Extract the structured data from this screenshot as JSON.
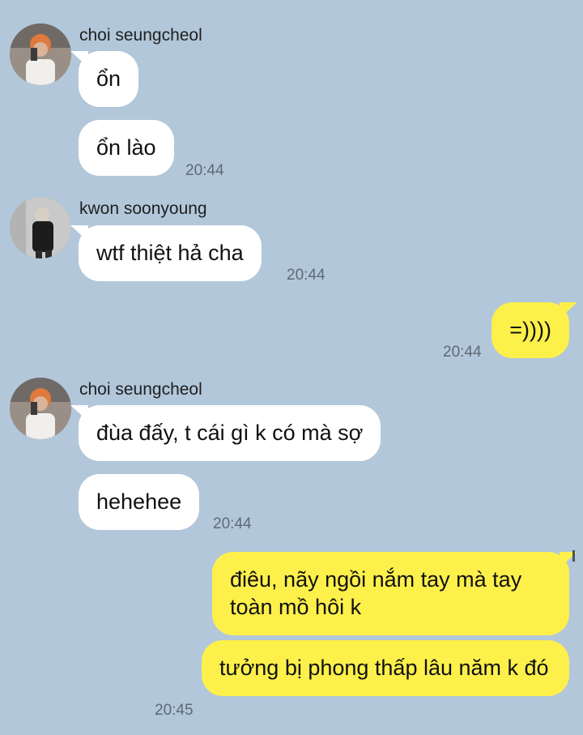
{
  "colors": {
    "background": "#b2c7da",
    "incoming_bubble": "#ffffff",
    "outgoing_bubble": "#fdf04b",
    "timestamp": "#5e6a74"
  },
  "groups": [
    {
      "sender": "choi seungcheol",
      "avatar_icon": "profile-photo-orange-hair",
      "messages": [
        "ổn",
        "ổn lào"
      ],
      "time": "20:44"
    },
    {
      "sender": "kwon soonyoung",
      "avatar_icon": "profile-photo-black-outfit",
      "messages": [
        "wtf thiệt hả cha"
      ],
      "time": "20:44"
    },
    {
      "sender": "",
      "outgoing": true,
      "messages": [
        "=))))"
      ],
      "time": "20:44"
    },
    {
      "sender": "choi seungcheol",
      "avatar_icon": "profile-photo-orange-hair",
      "messages": [
        "đùa đấy, t cái gì k có mà sợ",
        "hehehee"
      ],
      "time": "20:44"
    },
    {
      "sender": "",
      "outgoing": true,
      "messages": [
        "điêu, nãy ngồi nắm tay mà tay toàn mồ hôi k",
        "tưởng bị phong thấp lâu năm k đó"
      ],
      "time": "20:45"
    }
  ]
}
